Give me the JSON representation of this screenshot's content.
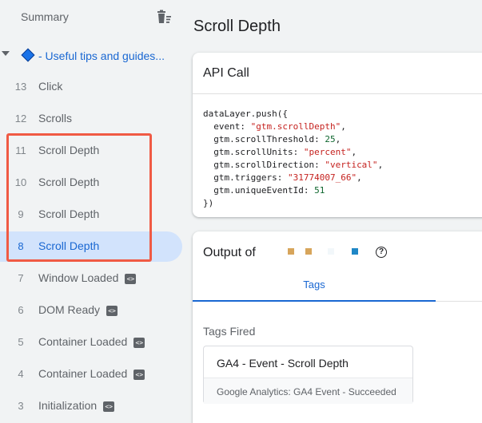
{
  "sidebar": {
    "title": "Summary",
    "group_label": "- Useful tips and guides...",
    "events": [
      {
        "num": "13",
        "label": "Click",
        "badge": false
      },
      {
        "num": "12",
        "label": "Scrolls",
        "badge": false
      },
      {
        "num": "11",
        "label": "Scroll Depth",
        "badge": false
      },
      {
        "num": "10",
        "label": "Scroll Depth",
        "badge": false
      },
      {
        "num": "9",
        "label": "Scroll Depth",
        "badge": false
      },
      {
        "num": "8",
        "label": "Scroll Depth",
        "badge": false,
        "selected": true
      },
      {
        "num": "7",
        "label": "Window Loaded",
        "badge": true
      },
      {
        "num": "6",
        "label": "DOM Ready",
        "badge": true
      },
      {
        "num": "5",
        "label": "Container Loaded",
        "badge": true
      },
      {
        "num": "4",
        "label": "Container Loaded",
        "badge": true
      },
      {
        "num": "3",
        "label": "Initialization",
        "badge": true
      }
    ],
    "badge_glyph": "<>"
  },
  "main": {
    "title": "Scroll Depth",
    "api_call": {
      "title": "API Call",
      "code": {
        "line1": "dataLayer.push({",
        "event_key": "  event: ",
        "event_val": "\"gtm.scrollDepth\"",
        "threshold_key": "  gtm.scrollThreshold: ",
        "threshold_val": "25",
        "units_key": "  gtm.scrollUnits: ",
        "units_val": "\"percent\"",
        "direction_key": "  gtm.scrollDirection: ",
        "direction_val": "\"vertical\"",
        "triggers_key": "  gtm.triggers: ",
        "triggers_val": "\"31774007_66\"",
        "eventid_key": "  gtm.uniqueEventId: ",
        "eventid_val": "51",
        "close": "})"
      }
    },
    "output": {
      "title": "Output of",
      "dot_colors": [
        "#d7a55b",
        "#d7a55b",
        "#f2f7fa",
        "#1f87c6"
      ],
      "help_glyph": "?",
      "tab_label": "Tags",
      "tags_fired_label": "Tags Fired",
      "tag_name": "GA4 - Event - Scroll Depth",
      "tag_status": "Google Analytics: GA4 Event - Succeeded"
    }
  },
  "colors": {
    "accent": "#1967d2",
    "selected_bg": "#d2e3fc",
    "highlight": "#f05a44"
  }
}
